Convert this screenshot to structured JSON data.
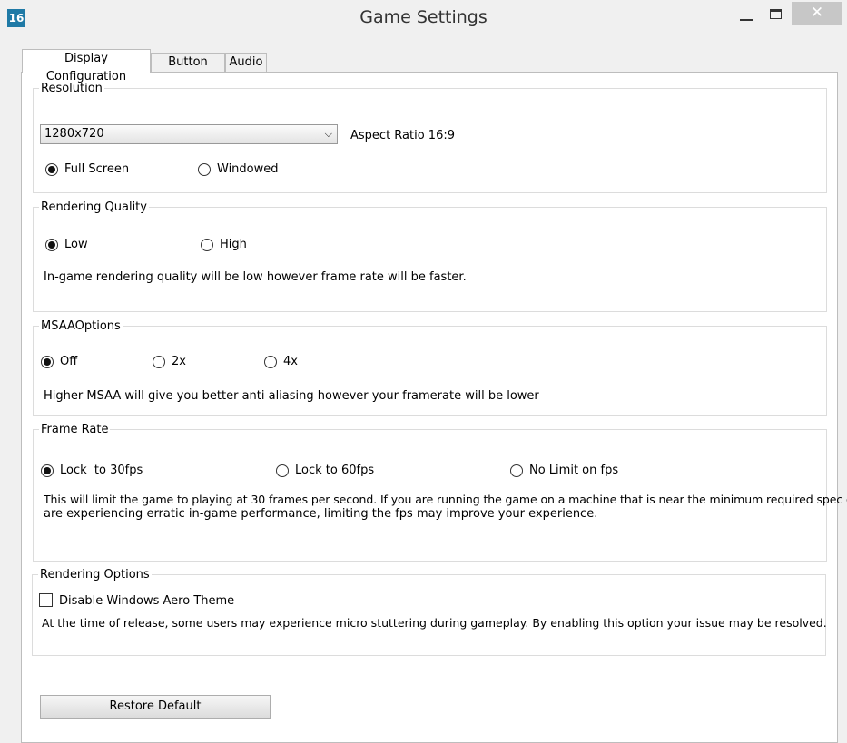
{
  "window": {
    "icon_text": "16",
    "title": "Game Settings",
    "close_glyph": "✕"
  },
  "tabs": [
    "Display Configuration",
    "Button Icons",
    "Audio"
  ],
  "resolution": {
    "label": "Resolution",
    "selected": "1280x720",
    "aspect": "Aspect Ratio 16:9",
    "modes": [
      "Full Screen",
      "Windowed"
    ],
    "mode_selected": 0
  },
  "quality": {
    "label": "Rendering Quality",
    "options": [
      "Low",
      "High"
    ],
    "selected": 0,
    "description": "In-game rendering quality will be low however frame rate will be faster."
  },
  "msaa": {
    "label": "MSAAOptions",
    "options": [
      "Off",
      "2x",
      "4x"
    ],
    "selected": 0,
    "description": "Higher MSAA will give you better anti aliasing however your framerate will be lower"
  },
  "framerate": {
    "label": "Frame Rate",
    "options": [
      "Lock  to 30fps",
      "Lock to 60fps",
      "No Limit on fps"
    ],
    "selected": 0,
    "description_line1": "This will limit the game to playing at 30 frames per second. If you are running the game on a machine that is near the minimum required spec or",
    "description_line2": "are experiencing erratic in-game performance, limiting the fps may improve your experience."
  },
  "rendering_options": {
    "label": "Rendering Options",
    "checkbox_label": "Disable Windows Aero Theme",
    "checked": false,
    "description": "At the time of release, some users may experience micro stuttering during gameplay. By enabling this option your issue may be resolved."
  },
  "restore_label": "Restore Default",
  "colors": {
    "icon_bg": "#1f7aa6",
    "close_bg": "#c7c7c7"
  }
}
